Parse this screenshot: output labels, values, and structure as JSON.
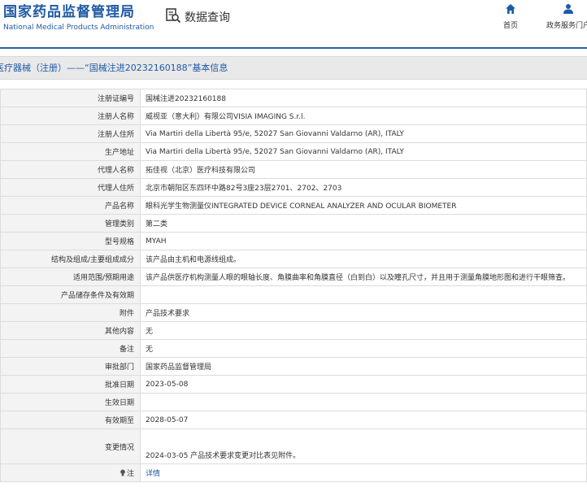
{
  "header": {
    "logo_cn": "国家药品监督管理局",
    "logo_en": "National Medical Products Administration",
    "query_label": "数据查询",
    "nav": [
      {
        "label": "首页",
        "icon": "home-icon"
      },
      {
        "label": "政务服务门户",
        "icon": "user-icon"
      }
    ],
    "accent_color": "#1f5aa6"
  },
  "title": "医疗器械（注册）——“国械注进20232160188”基本信息",
  "rows": [
    {
      "label": "注册证编号",
      "value": "国械注进20232160188"
    },
    {
      "label": "注册人名称",
      "value": "威视亚（意大利）有限公司VISIA IMAGING S.r.l."
    },
    {
      "label": "注册人住所",
      "value": "Via Martiri della Libertà 95/e, 52027 San Giovanni Valdarno (AR), ITALY"
    },
    {
      "label": "生产地址",
      "value": "Via Martiri della Libertà 95/e, 52027 San Giovanni Valdarno (AR), ITALY"
    },
    {
      "label": "代理人名称",
      "value": "拓佳视（北京）医疗科技有限公司"
    },
    {
      "label": "代理人住所",
      "value": "北京市朝阳区东四环中路82号3座23层2701、2702、2703"
    },
    {
      "label": "产品名称",
      "value": "眼科光学生物测量仪INTEGRATED DEVICE CORNEAL ANALYZER AND OCULAR BIOMETER"
    },
    {
      "label": "管理类别",
      "value": "第二类"
    },
    {
      "label": "型号规格",
      "value": "MYAH"
    },
    {
      "label": "结构及组成/主要组成成分",
      "value": "该产品由主机和电源线组成。"
    },
    {
      "label": "适用范围/预期用途",
      "value": "该产品供医疗机构测量人眼的眼轴长度、角膜曲率和角膜直径（白到白）以及瞳孔尺寸，并且用于测量角膜地形图和进行干眼筛查。"
    },
    {
      "label": "产品储存条件及有效期",
      "value": ""
    },
    {
      "label": "附件",
      "value": "产品技术要求"
    },
    {
      "label": "其他内容",
      "value": "无"
    },
    {
      "label": "备注",
      "value": "无"
    },
    {
      "label": "审批部门",
      "value": "国家药品监督管理局"
    },
    {
      "label": "批准日期",
      "value": "2023-05-08"
    },
    {
      "label": "生效日期",
      "value": ""
    },
    {
      "label": "有效期至",
      "value": "2028-05-07"
    },
    {
      "label": "变更情况",
      "value": "2024-03-05 产品技术要求变更对比表见附件。"
    },
    {
      "label": "注",
      "value": "详情"
    }
  ]
}
